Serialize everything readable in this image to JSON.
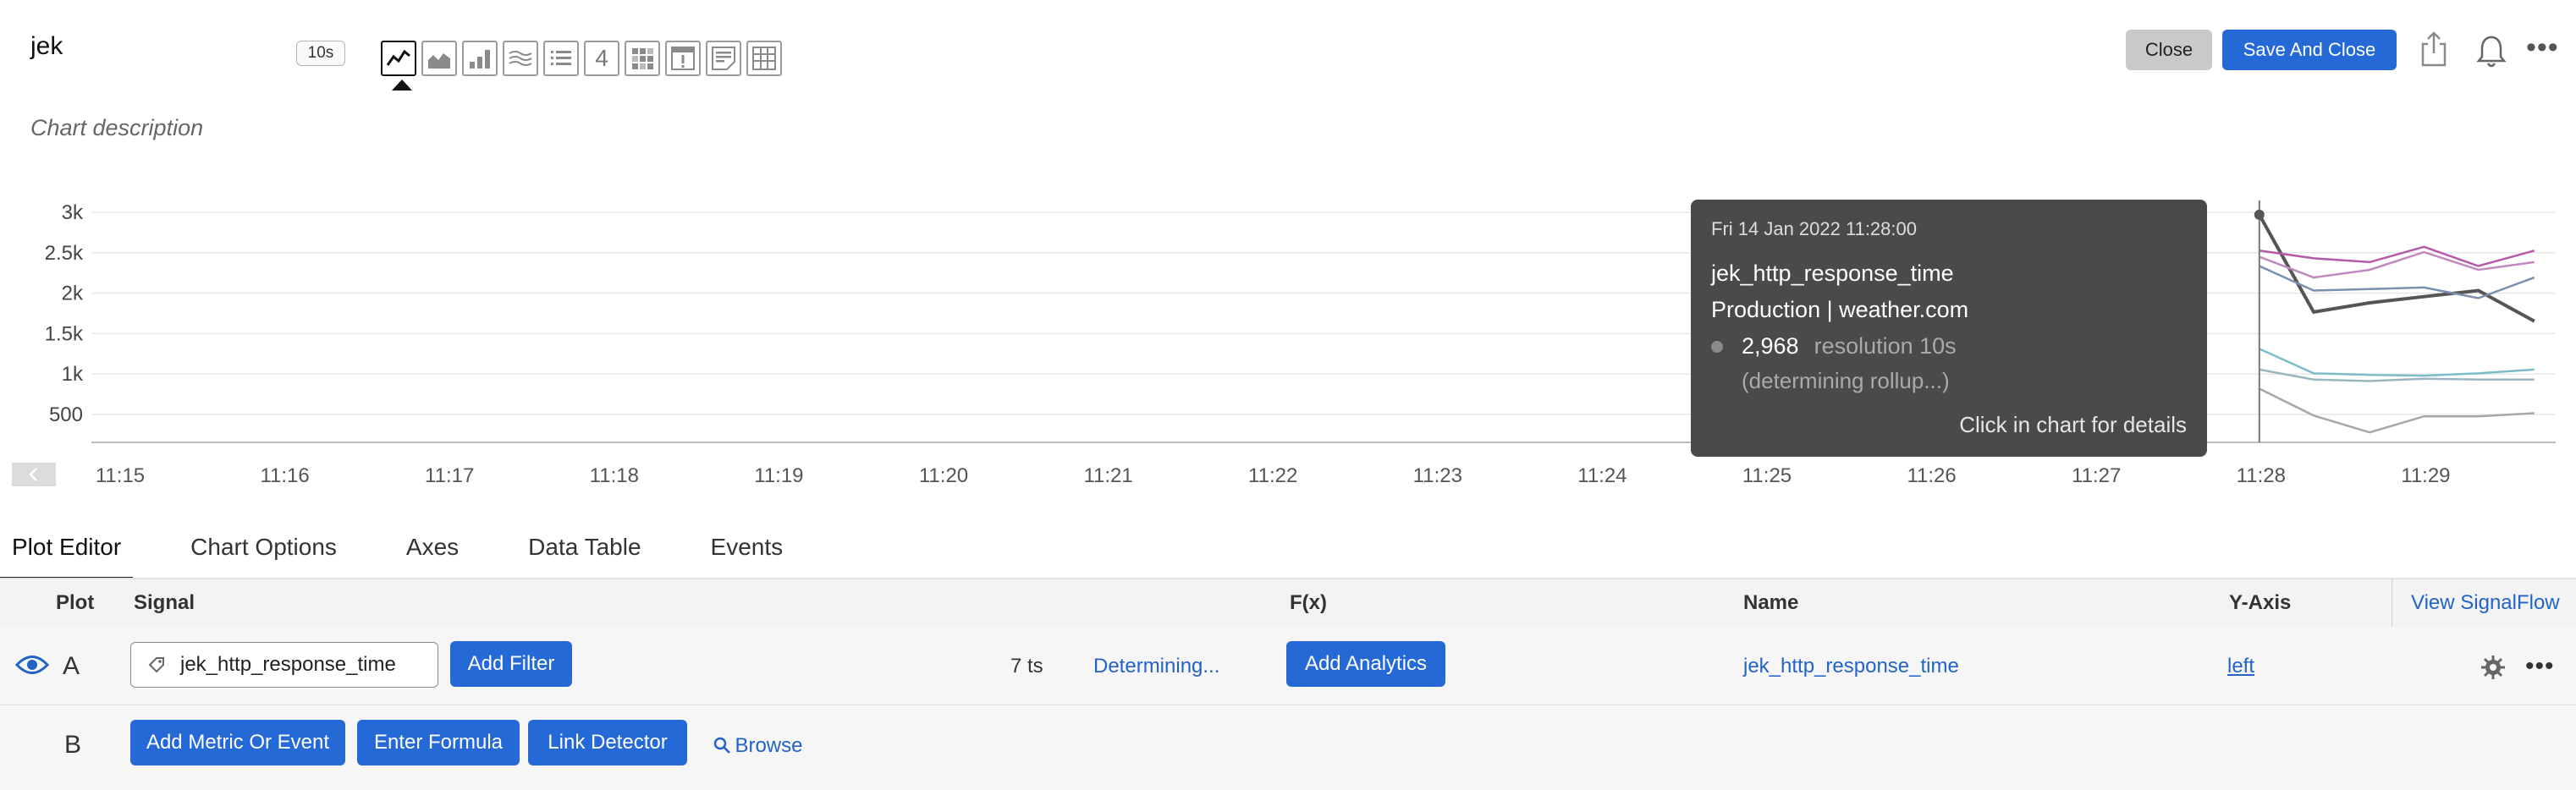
{
  "header": {
    "title": "jek",
    "resolution": "10s",
    "chart_types": [
      "line-chart-icon",
      "area-chart-icon",
      "column-chart-icon",
      "histogram-chart-icon",
      "list-chart-icon",
      "single-value-chart-icon",
      "heatmap-chart-icon",
      "event-feed-icon",
      "text-note-icon",
      "table-chart-icon"
    ],
    "single_value_glyph": "4",
    "close_label": "Close",
    "save_label": "Save And Close",
    "description_placeholder": "Chart description"
  },
  "chart_data": {
    "type": "line",
    "y_ticks": [
      "3k",
      "2.5k",
      "2k",
      "1.5k",
      "1k",
      "500"
    ],
    "x_ticks": [
      "11:15",
      "11:16",
      "11:17",
      "11:18",
      "11:19",
      "11:20",
      "11:21",
      "11:22",
      "11:23",
      "11:24",
      "11:25",
      "11:26",
      "11:27",
      "11:28",
      "11:29"
    ],
    "ylim": [
      0,
      3000
    ],
    "x_minutes": [
      0.0,
      0.33,
      0.67,
      1.0,
      1.33,
      1.67
    ],
    "series": [
      {
        "color": "#555555",
        "values": [
          2968,
          1700,
          1820,
          1900,
          1980,
          1580
        ]
      },
      {
        "color": "#b45aa8",
        "values": [
          2500,
          2400,
          2350,
          2550,
          2300,
          2500
        ]
      },
      {
        "color": "#c08ac0",
        "values": [
          2420,
          2150,
          2250,
          2480,
          2250,
          2350
        ]
      },
      {
        "color": "#7b8fae",
        "values": [
          2300,
          1980,
          2000,
          2020,
          1880,
          2150
        ]
      },
      {
        "color": "#7dbdc8",
        "values": [
          1220,
          900,
          880,
          870,
          900,
          950
        ]
      },
      {
        "color": "#9bb6c0",
        "values": [
          950,
          820,
          800,
          830,
          820,
          820
        ]
      },
      {
        "color": "#a7a7a7",
        "values": [
          700,
          350,
          130,
          340,
          340,
          380
        ]
      }
    ],
    "grid": true
  },
  "tooltip": {
    "date": "Fri 14 Jan 2022 11:28:00",
    "metric": "jek_http_response_time",
    "dimensions": "Production | weather.com",
    "value": "2,968",
    "resolution": "resolution 10s",
    "rollup": "(determining rollup...)",
    "hint": "Click in chart for details"
  },
  "tabs": [
    "Plot Editor",
    "Chart Options",
    "Axes",
    "Data Table",
    "Events"
  ],
  "table": {
    "headers": {
      "plot": "Plot",
      "signal": "Signal",
      "fx": "F(x)",
      "name": "Name",
      "yaxis": "Y-Axis"
    },
    "view_signalflow": "View SignalFlow",
    "row_a": {
      "letter": "A",
      "signal": "jek_http_response_time",
      "add_filter": "Add Filter",
      "ts_count": "7 ts",
      "status": "Determining...",
      "add_analytics": "Add Analytics",
      "name": "jek_http_response_time",
      "yaxis": "left"
    },
    "row_b": {
      "letter": "B",
      "add_metric": "Add Metric Or Event",
      "enter_formula": "Enter Formula",
      "link_detector": "Link Detector",
      "browse": "Browse"
    }
  }
}
